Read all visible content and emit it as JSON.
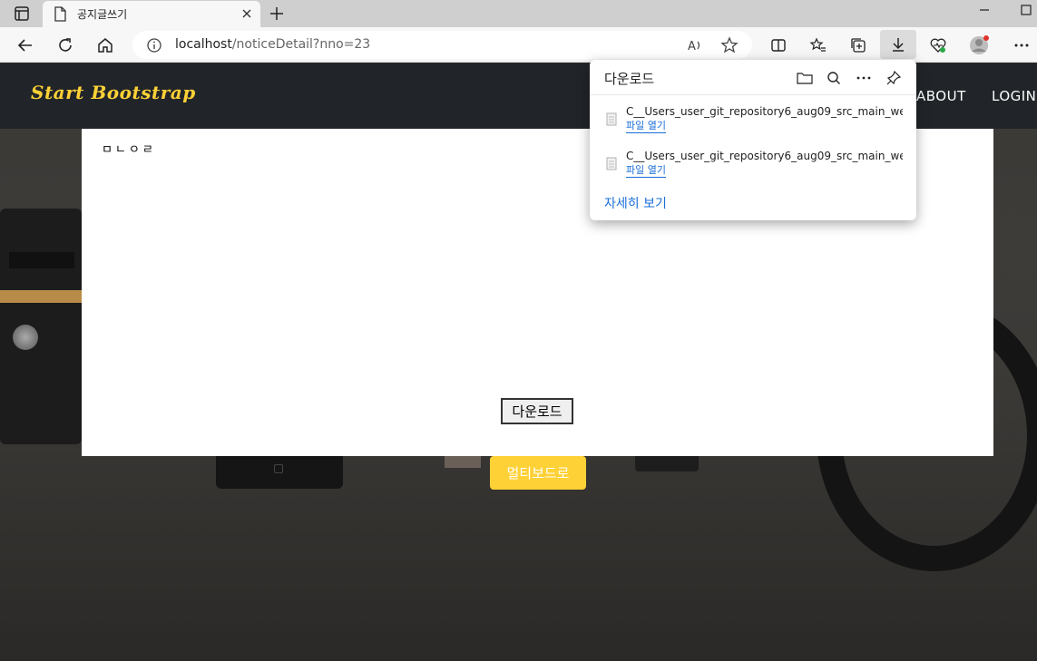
{
  "browser": {
    "tab_title": "공지글쓰기",
    "url_host": "localhost",
    "url_path": "/noticeDetail?nno=23"
  },
  "navbar": {
    "brand": "Start Bootstrap",
    "links": [
      "ABOUT",
      "LOGIN"
    ]
  },
  "card": {
    "content_text": "ㅁㄴㅇㄹ",
    "download_button": "다운로드"
  },
  "multiboard_button": "멀티보드로",
  "download_panel": {
    "title": "다운로드",
    "items": [
      {
        "filename": "C__Users_user_git_repository6_aug09_src_main_webap...",
        "action": "파일 열기"
      },
      {
        "filename": "C__Users_user_git_repository6_aug09_src_main_webap...",
        "action": "파일 열기"
      }
    ],
    "see_more": "자세히 보기"
  },
  "colors": {
    "accent": "#fed136",
    "navbar_bg": "#212529",
    "link_blue": "#1a6ed8"
  }
}
